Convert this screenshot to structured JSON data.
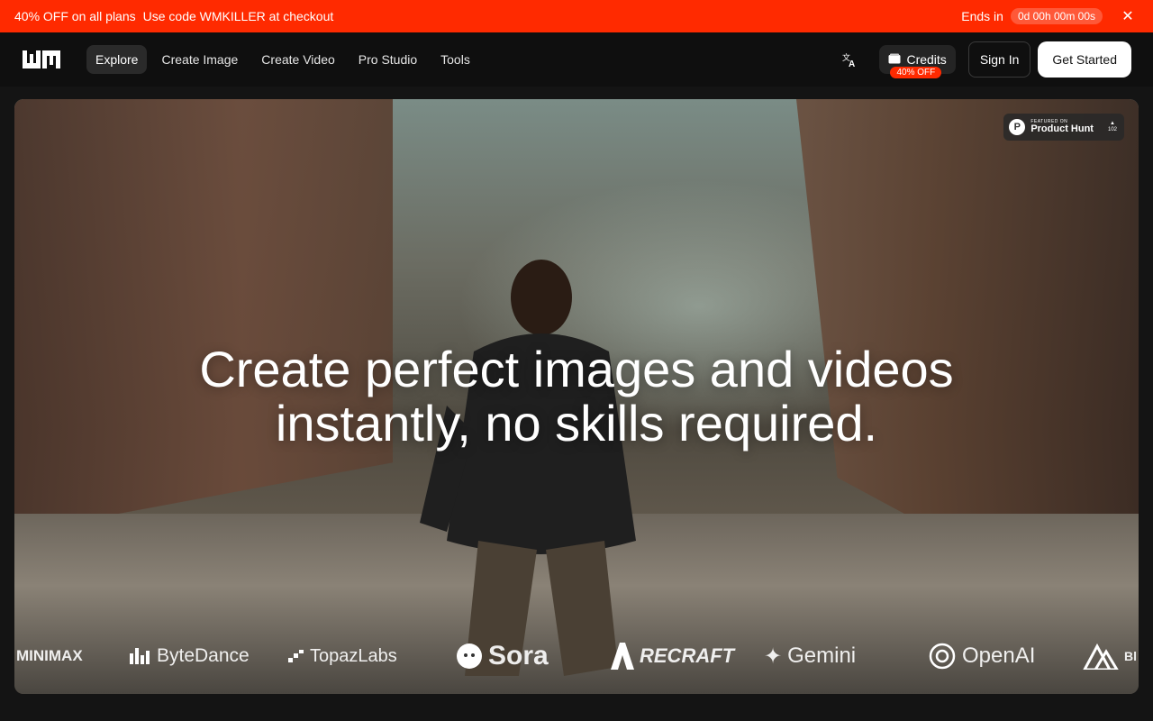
{
  "promo": {
    "offer": "40% OFF on all plans",
    "code_text": "Use code WMKILLER at checkout",
    "ends_label": "Ends in",
    "timer": "0d 00h 00m 00s",
    "close_icon": "close-icon",
    "color": "#ff2a00"
  },
  "nav": {
    "logo": "WM",
    "links": [
      {
        "label": "Explore",
        "active": true
      },
      {
        "label": "Create Image"
      },
      {
        "label": "Create Video"
      },
      {
        "label": "Pro Studio"
      },
      {
        "label": "Tools"
      }
    ],
    "translate_icon": "translate-icon",
    "credits": {
      "label": "Credits",
      "badge": "40% OFF",
      "icon": "wallet-icon"
    },
    "sign_in": "Sign In",
    "get_started": "Get Started"
  },
  "hero": {
    "headline_line1": "Create perfect images and videos",
    "headline_line2": "instantly, no skills required.",
    "product_hunt": {
      "featured": "FEATURED ON",
      "name": "Product Hunt",
      "votes": "102"
    },
    "partner_logos": [
      "MINIMAX",
      "ByteDance",
      "TopazLabs",
      "Sora",
      "RECRAFT",
      "Gemini",
      "OpenAI",
      "Bl Fo"
    ]
  }
}
